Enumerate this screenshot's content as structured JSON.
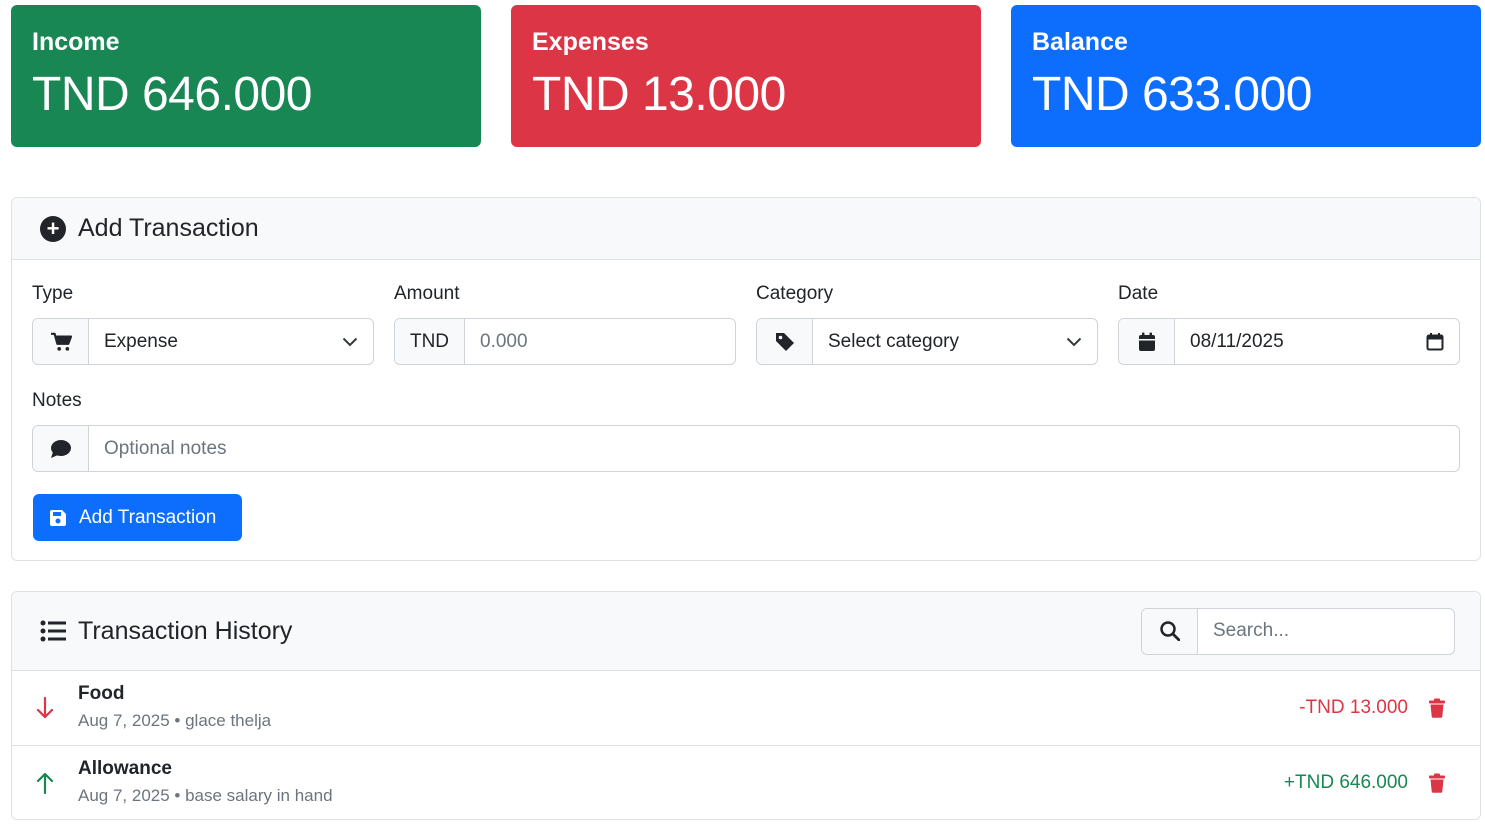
{
  "summary": {
    "income": {
      "title": "Income",
      "amount": "TND 646.000"
    },
    "expenses": {
      "title": "Expenses",
      "amount": "TND 13.000"
    },
    "balance": {
      "title": "Balance",
      "amount": "TND 633.000"
    }
  },
  "add_transaction": {
    "title": "Add Transaction",
    "type": {
      "label": "Type",
      "value": "Expense"
    },
    "amount": {
      "label": "Amount",
      "currency": "TND",
      "placeholder": "0.000"
    },
    "category": {
      "label": "Category",
      "value": "Select category"
    },
    "date": {
      "label": "Date",
      "value": "08/11/2025"
    },
    "notes": {
      "label": "Notes",
      "placeholder": "Optional notes"
    },
    "submit_label": "Add Transaction"
  },
  "history": {
    "title": "Transaction History",
    "search_placeholder": "Search...",
    "items": [
      {
        "category": "Food",
        "meta": "Aug 7, 2025 • glace thelja",
        "amount": "-TND 13.000",
        "kind": "expense"
      },
      {
        "category": "Allowance",
        "meta": "Aug 7, 2025 • base salary in hand",
        "amount": "+TND 646.000",
        "kind": "income"
      }
    ]
  },
  "colors": {
    "income": "#198754",
    "expense": "#dc3545",
    "balance": "#0d6efd",
    "primary": "#0d6efd"
  },
  "icons": [
    "plus-circle-icon",
    "cart-icon",
    "chevron-down-icon",
    "tag-icon",
    "calendar-icon",
    "calendar-picker-icon",
    "comment-icon",
    "save-icon",
    "list-icon",
    "search-icon",
    "arrow-down-icon",
    "arrow-up-icon",
    "trash-icon"
  ]
}
